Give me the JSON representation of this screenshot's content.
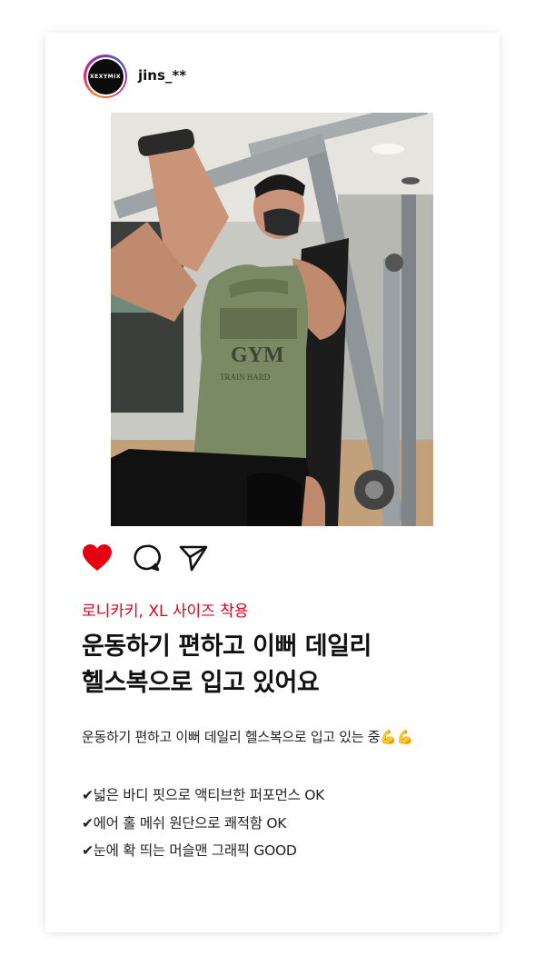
{
  "post": {
    "username": "jins_**",
    "avatar_text": "XEXYMIX"
  },
  "photo": {
    "shirt_print": "GYM",
    "shirt_sub": "TRAIN HARD"
  },
  "actions": {
    "icons": [
      "heart-icon",
      "comment-icon",
      "share-icon"
    ],
    "heart_color": "#e60012"
  },
  "caption": {
    "tag": "로니카키, XL 사이즈 착용",
    "title_lines": [
      "운동하기 편하고 이뻐 데일리",
      "헬스복으로 입고 있어요"
    ],
    "description": "운동하기 편하고 이뻐 데일리 헬스복으로 입고 있는 중💪💪",
    "points": [
      "✔넓은 바디 핏으로 액티브한 퍼포먼스 OK",
      "✔에어 홀 메쉬 원단으로 쾌적함 OK",
      "✔눈에 확 띄는 머슬맨 그래픽 GOOD"
    ]
  },
  "colors": {
    "accent_red": "#e2001a"
  }
}
